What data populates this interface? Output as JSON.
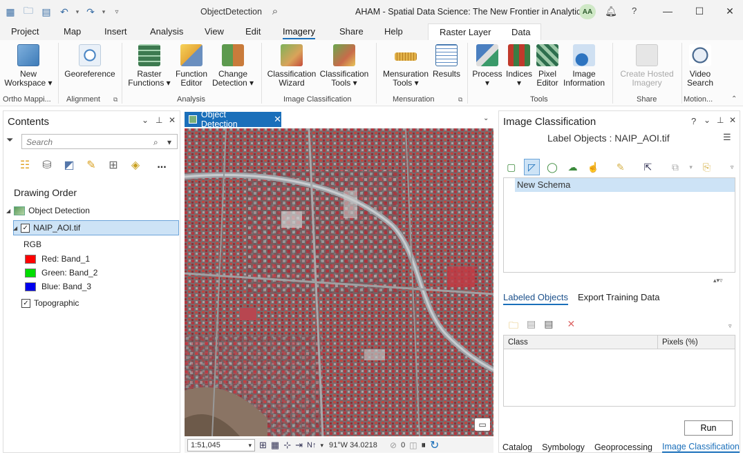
{
  "window": {
    "doc_title": "ObjectDetection",
    "project_title": "AHAM - Spatial Data Science:  The New Frontier in Analytics",
    "avatar": "AA",
    "help": "?",
    "minimize": "—",
    "maximize": "☐",
    "close": "✕"
  },
  "ribbon_tabs": [
    "Project",
    "Map",
    "Insert",
    "Analysis",
    "View",
    "Edit",
    "Imagery",
    "Share",
    "Help"
  ],
  "context_tabs": [
    "Raster Layer",
    "Data"
  ],
  "ribbon": {
    "new_workspace": "New\nWorkspace ▾",
    "georeference": "Georeference",
    "raster_functions": "Raster\nFunctions ▾",
    "function_editor": "Function\nEditor",
    "change_detection": "Change\nDetection ▾",
    "classification_wizard": "Classification\nWizard",
    "classification_tools": "Classification\nTools ▾",
    "mensuration_tools": "Mensuration\nTools ▾",
    "results": "Results",
    "process": "Process\n▾",
    "indices": "Indices\n▾",
    "pixel_editor": "Pixel\nEditor",
    "image_information": "Image\nInformation",
    "create_hosted_imagery": "Create Hosted\nImagery",
    "video_search": "Video\nSearch",
    "groups": {
      "ortho": "Ortho Mappi...",
      "alignment": "Alignment",
      "analysis": "Analysis",
      "image_classification": "Image Classification",
      "mensuration": "Mensuration",
      "tools": "Tools",
      "share": "Share",
      "motion": "Motion..."
    }
  },
  "contents": {
    "title": "Contents",
    "search_placeholder": "Search",
    "drawing_order": "Drawing Order",
    "map_name": "Object Detection",
    "layer": "NAIP_AOI.tif",
    "renderer": "RGB",
    "bands": [
      {
        "label": "Red:  Band_1",
        "color": "#ff0000"
      },
      {
        "label": "Green: Band_2",
        "color": "#00dd00"
      },
      {
        "label": "Blue:  Band_3",
        "color": "#0000ee"
      }
    ],
    "basemap": "Topographic",
    "more": "..."
  },
  "map": {
    "tab_label": "Object Detection",
    "scale": "1:51,045",
    "coords": "91°W 34.0218",
    "rotation": "0"
  },
  "image_classification": {
    "title": "Image Classification",
    "subtitle": "Label Objects : NAIP_AOI.tif",
    "schema_item": "New Schema",
    "tab_labeled": "Labeled Objects",
    "tab_export": "Export Training Data",
    "col_class": "Class",
    "col_pixels": "Pixels (%)",
    "run": "Run"
  },
  "bottom_tabs": [
    "Catalog",
    "Symbology",
    "Geoprocessing",
    "Image Classification"
  ]
}
